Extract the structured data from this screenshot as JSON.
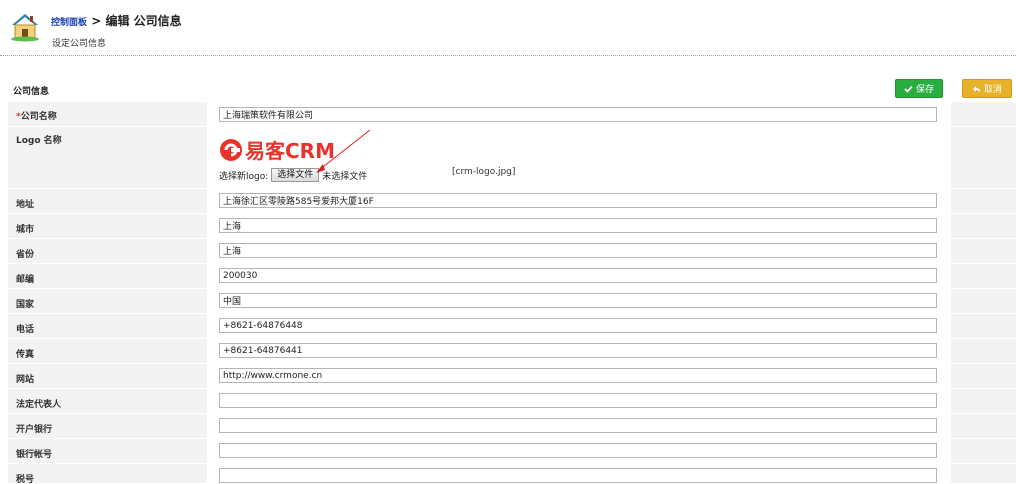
{
  "header": {
    "breadcrumb_link": "控制面板",
    "breadcrumb_sep": ">",
    "title": "编辑 公司信息",
    "subtitle": "设定公司信息"
  },
  "section": {
    "title": "公司信息",
    "save_label": "保存",
    "cancel_label": "取消"
  },
  "colors": {
    "save": "#27ae3f",
    "cancel": "#e8b12a",
    "required": "#dd3333",
    "link": "#1a3fb0",
    "logo_red": "#e8322b"
  },
  "form": {
    "company_name": {
      "label": "公司名称",
      "required_mark": "*",
      "value": "上海瑞策软件有限公司"
    },
    "logo": {
      "label": "Logo 名称",
      "logo_text": "易客CRM",
      "choose_prefix": "选择新logo:",
      "choose_button": "选择文件",
      "no_file": "未选择文件",
      "current_file": "[crm-logo.jpg]"
    },
    "address": {
      "label": "地址",
      "value": "上海徐汇区零陵路585号爱邦大厦16F"
    },
    "city": {
      "label": "城市",
      "value": "上海"
    },
    "province": {
      "label": "省份",
      "value": "上海"
    },
    "postcode": {
      "label": "邮编",
      "value": "200030"
    },
    "country": {
      "label": "国家",
      "value": "中国"
    },
    "phone": {
      "label": "电话",
      "value": "+8621-64876448"
    },
    "fax": {
      "label": "传真",
      "value": "+8621-64876441"
    },
    "website": {
      "label": "网站",
      "value": "http://www.crmone.cn"
    },
    "legal_rep": {
      "label": "法定代表人",
      "value": ""
    },
    "bank": {
      "label": "开户银行",
      "value": ""
    },
    "bank_account": {
      "label": "银行帐号",
      "value": ""
    },
    "tax_no": {
      "label": "税号",
      "value": ""
    }
  }
}
